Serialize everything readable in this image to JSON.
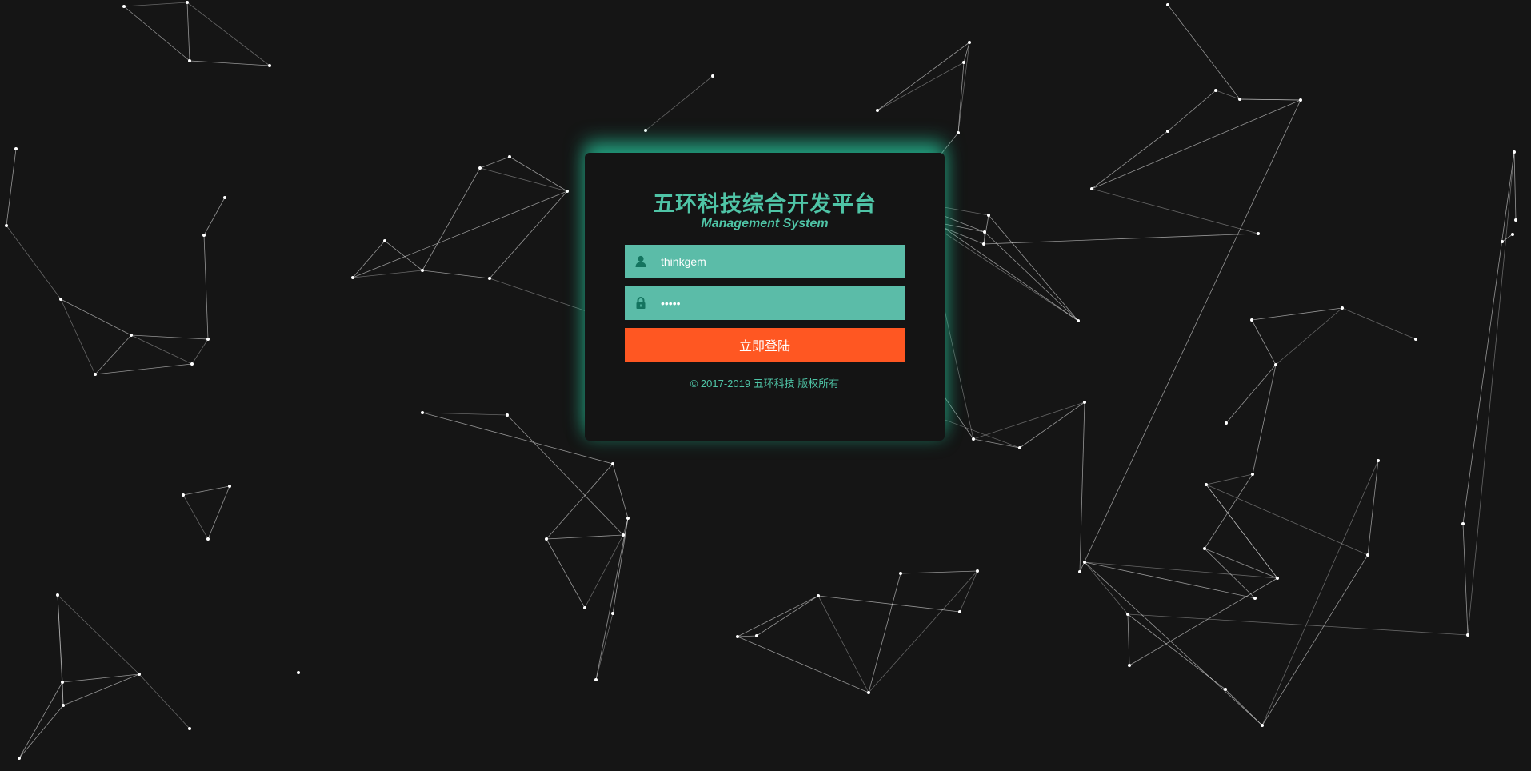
{
  "login": {
    "title": "五环科技综合开发平台",
    "subtitle": "Management System",
    "username_value": "thinkgem",
    "password_value": "•••••",
    "submit_label": "立即登陆",
    "copyright": "© 2017-2019 五环科技 版权所有",
    "icons": {
      "username": "user-icon",
      "password": "lock-icon"
    }
  },
  "theme": {
    "background": "#151515",
    "card_background": "#141414",
    "accent": "#4fc4a6",
    "field_background": "#5bbca8",
    "button_background": "#ff5722",
    "glow": "#26be96",
    "particle_color": "#ffffff"
  }
}
